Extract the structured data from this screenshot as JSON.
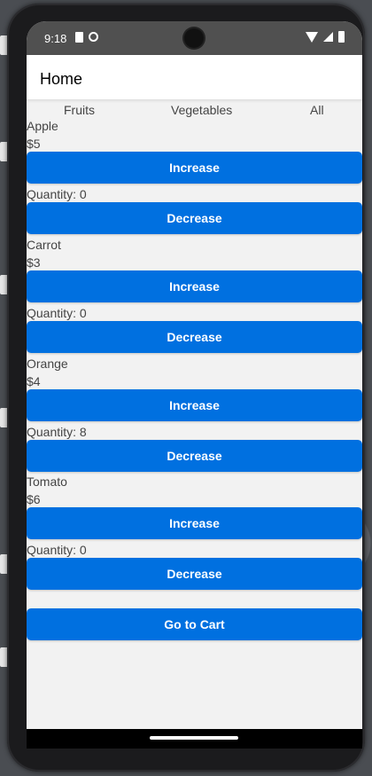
{
  "status_bar": {
    "time": "9:18",
    "icons": [
      "sim-card-icon",
      "data-saver-icon",
      "wifi-icon",
      "cell-signal-icon",
      "battery-icon"
    ]
  },
  "app_bar": {
    "title": "Home"
  },
  "tabs": [
    {
      "label": "Fruits"
    },
    {
      "label": "Vegetables"
    },
    {
      "label": "All"
    }
  ],
  "products": [
    {
      "name": "Apple",
      "price": "$5",
      "quantity": "Quantity: 0",
      "increase_label": "Increase",
      "decrease_label": "Decrease"
    },
    {
      "name": "Carrot",
      "price": "$3",
      "quantity": "Quantity: 0",
      "increase_label": "Increase",
      "decrease_label": "Decrease"
    },
    {
      "name": "Orange",
      "price": "$4",
      "quantity": "Quantity: 8",
      "increase_label": "Increase",
      "decrease_label": "Decrease"
    },
    {
      "name": "Tomato",
      "price": "$6",
      "quantity": "Quantity: 0",
      "increase_label": "Increase",
      "decrease_label": "Decrease"
    }
  ],
  "cart_button": {
    "label": "Go to Cart"
  },
  "colors": {
    "primary_button": "#0070e0",
    "background": "#f2f2f2",
    "status_bar": "#505050"
  }
}
